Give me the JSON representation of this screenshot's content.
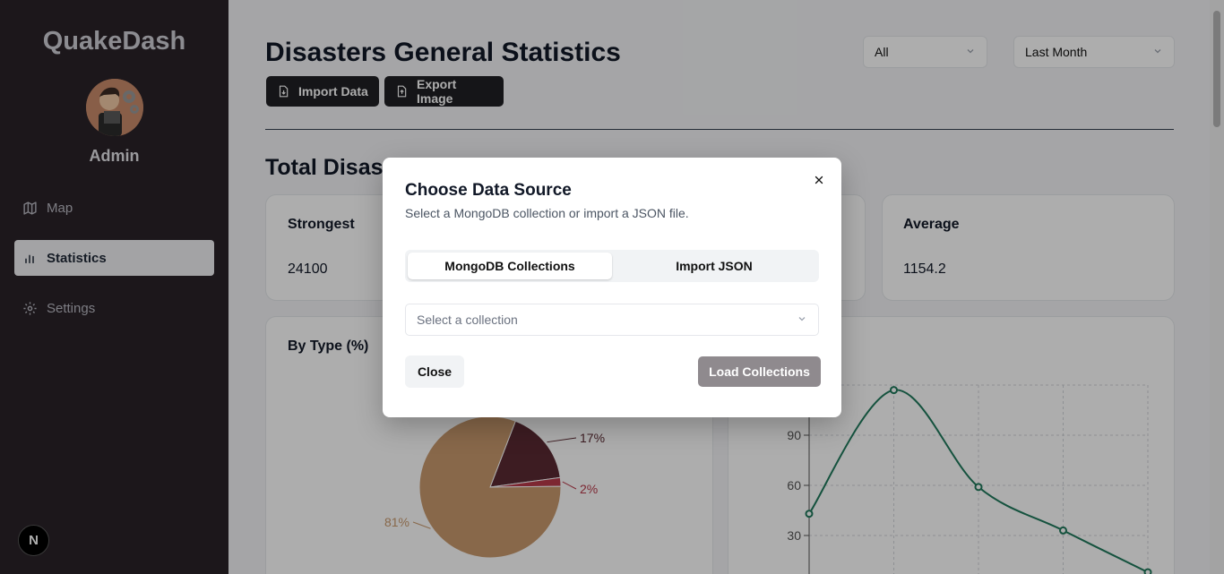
{
  "sidebar": {
    "brand": "QuakeDash",
    "user_name": "Admin",
    "items": [
      {
        "label": "Map",
        "icon": "map-icon"
      },
      {
        "label": "Statistics",
        "icon": "bar-chart-icon",
        "active": true
      },
      {
        "label": "Settings",
        "icon": "gear-icon"
      }
    ],
    "badge_letter": "N"
  },
  "header": {
    "title": "Disasters General Statistics",
    "import_label": "Import Data",
    "export_label": "Export Image",
    "filter_type": "All",
    "filter_period": "Last Month"
  },
  "summary": {
    "section_title": "Total Disasters",
    "strongest_label": "Strongest",
    "strongest_value": "24100",
    "average_label": "Average",
    "average_value": "1154.2"
  },
  "pie_chart": {
    "title": "By Type (%)",
    "slices": [
      {
        "label": "81%",
        "value": 81,
        "color": "#c99a6e"
      },
      {
        "label": "17%",
        "value": 17,
        "color": "#5b2a33"
      },
      {
        "label": "2%",
        "value": 2,
        "color": "#b83a4b"
      }
    ]
  },
  "chart_data": {
    "type": "line",
    "x": [
      0,
      1,
      2,
      3,
      4
    ],
    "values": [
      43,
      117,
      59,
      33,
      8
    ],
    "ylim": [
      0,
      120
    ],
    "yticks": [
      "30",
      "60",
      "90"
    ],
    "grid": true,
    "line_color": "#1f7a5c"
  },
  "modal": {
    "title": "Choose Data Source",
    "description": "Select a MongoDB collection or import a JSON file.",
    "tabs": [
      {
        "label": "MongoDB Collections",
        "active": true
      },
      {
        "label": "Import JSON",
        "active": false
      }
    ],
    "collection_placeholder": "Select a collection",
    "close_label": "Close",
    "load_label": "Load Collections"
  }
}
